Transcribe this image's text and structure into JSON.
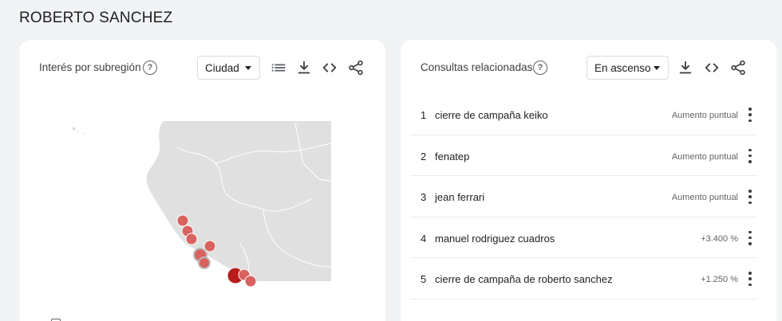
{
  "page": {
    "title": "ROBERTO SANCHEZ"
  },
  "subregion_card": {
    "title": "Interés por subregión",
    "help_icon": "help-circle-icon",
    "resolution_select": {
      "value": "Ciudad"
    },
    "tools": [
      "list-view-icon",
      "download-icon",
      "embed-code-icon",
      "share-icon"
    ]
  },
  "related_queries_card": {
    "title": "Consultas relacionadas",
    "help_icon": "help-circle-icon",
    "sort_select": {
      "value": "En ascenso"
    },
    "tools": [
      "download-icon",
      "embed-code-icon",
      "share-icon"
    ],
    "rows": [
      {
        "rank": "1",
        "query": "cierre de campaña keiko",
        "value": "Aumento puntual"
      },
      {
        "rank": "2",
        "query": "fenatep",
        "value": "Aumento puntual"
      },
      {
        "rank": "3",
        "query": "jean ferrari",
        "value": "Aumento puntual"
      },
      {
        "rank": "4",
        "query": "manuel rodriguez cuadros",
        "value": "+3.400 %"
      },
      {
        "rank": "5",
        "query": "cierre de campaña de roberto sanchez",
        "value": "+1.250 %"
      }
    ]
  },
  "colors": {
    "marker": "#d9625e",
    "marker_strong": "#b71c1c",
    "map_land": "#e0e0e0"
  }
}
